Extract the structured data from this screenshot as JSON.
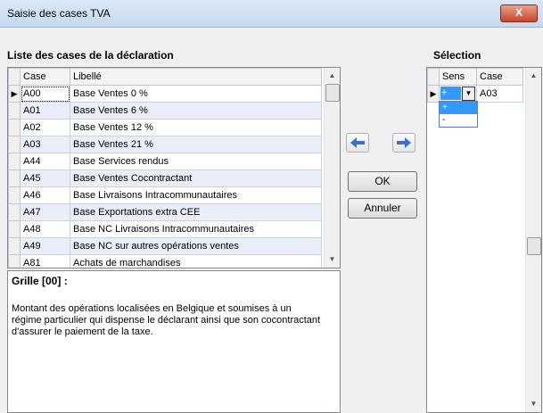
{
  "window": {
    "title": "Saisie des cases TVA",
    "close_label": "X"
  },
  "left_heading": "Liste des cases de la déclaration",
  "right_heading": "Sélection",
  "grid": {
    "columns": [
      "Case",
      "Libellé"
    ],
    "rows": [
      {
        "case": "A00",
        "libelle": "Base  Ventes 0 %"
      },
      {
        "case": "A01",
        "libelle": "Base  Ventes 6 %"
      },
      {
        "case": "A02",
        "libelle": "Base  Ventes 12 %"
      },
      {
        "case": "A03",
        "libelle": "Base  Ventes 21 %"
      },
      {
        "case": "A44",
        "libelle": "Base Services rendus"
      },
      {
        "case": "A45",
        "libelle": "Base  Ventes Cocontractant"
      },
      {
        "case": "A46",
        "libelle": "Base  Livraisons Intracommunautaires"
      },
      {
        "case": "A47",
        "libelle": "Base  Exportations extra CEE"
      },
      {
        "case": "A48",
        "libelle": "Base  NC Livraisons Intracommunautaires"
      },
      {
        "case": "A49",
        "libelle": "Base  NC sur autres opérations ventes"
      },
      {
        "case": "A81",
        "libelle": "Achats de marchandises"
      }
    ],
    "current_row_marker": "▶"
  },
  "description": {
    "title": "Grille [00] :",
    "text": "Montant des opérations localisées en Belgique et soumises à un régime particulier qui dispense le déclarant ainsi que son cocontractant d'assurer le paiement de la taxe."
  },
  "buttons": {
    "ok": "OK",
    "cancel": "Annuler"
  },
  "selection": {
    "columns": [
      "Sens",
      "Case"
    ],
    "row": {
      "sens": "+",
      "case": "A03"
    },
    "sens_options": [
      "+",
      "-"
    ]
  },
  "colors": {
    "arrow_blue": "#3b6fd6",
    "selection_blue": "#3399ff"
  }
}
